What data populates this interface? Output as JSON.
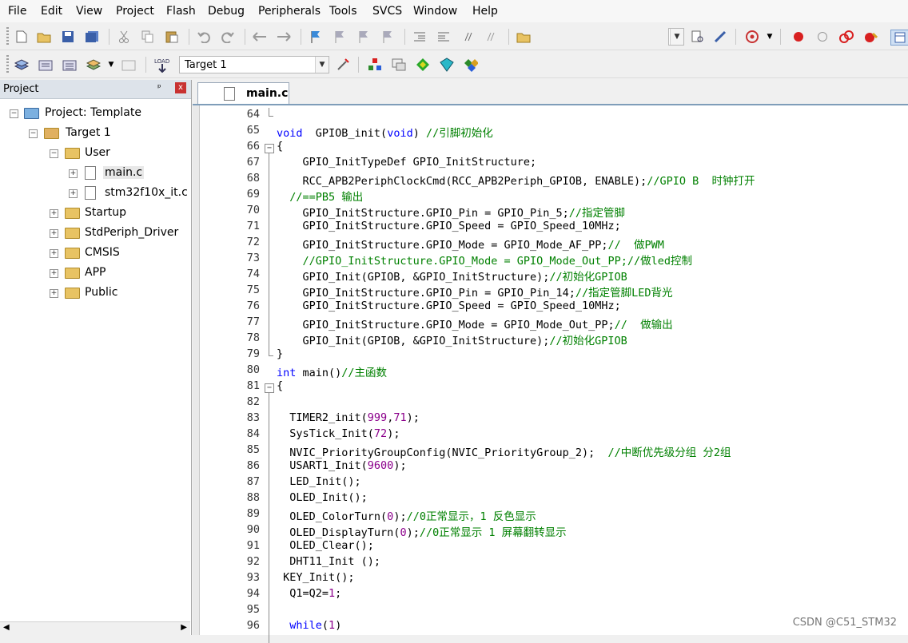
{
  "menu": [
    "File",
    "Edit",
    "View",
    "Project",
    "Flash",
    "Debug",
    "Peripherals",
    "Tools",
    "SVCS",
    "Window",
    "Help"
  ],
  "toolbar": {
    "target": "Target 1"
  },
  "project_panel": {
    "title": "Project",
    "pin": "ᵖ",
    "close": "x",
    "tree": [
      {
        "label": "Project: Template",
        "expander": "−"
      },
      {
        "label": "Target 1",
        "expander": "−"
      },
      {
        "label": "User",
        "expander": "−"
      },
      {
        "label": "main.c",
        "expander": "+"
      },
      {
        "label": "stm32f10x_it.c",
        "expander": "+"
      },
      {
        "label": "Startup",
        "expander": "+"
      },
      {
        "label": "StdPeriph_Driver",
        "expander": "+"
      },
      {
        "label": "CMSIS",
        "expander": "+"
      },
      {
        "label": "APP",
        "expander": "+"
      },
      {
        "label": "Public",
        "expander": "+"
      }
    ]
  },
  "editor": {
    "tab": "main.c",
    "lines": [
      {
        "n": "64",
        "p": []
      },
      {
        "n": "65",
        "p": [
          [
            "kw",
            "void"
          ],
          [
            "",
            "  GPIOB_init("
          ],
          [
            "kw",
            "void"
          ],
          [
            "",
            ") "
          ],
          [
            "cm",
            "//引脚初始化"
          ]
        ]
      },
      {
        "n": "66",
        "p": [
          [
            "",
            "{"
          ]
        ]
      },
      {
        "n": "67",
        "p": [
          [
            "",
            "    GPIO_InitTypeDef GPIO_InitStructure;"
          ]
        ]
      },
      {
        "n": "68",
        "p": [
          [
            "",
            "    RCC_APB2PeriphClockCmd(RCC_APB2Periph_GPIOB, ENABLE);"
          ],
          [
            "cm",
            "//GPIO B  时钟打开"
          ]
        ]
      },
      {
        "n": "69",
        "p": [
          [
            "cm",
            "  //==PB5 输出"
          ]
        ]
      },
      {
        "n": "70",
        "p": [
          [
            "",
            "    GPIO_InitStructure.GPIO_Pin = GPIO_Pin_5;"
          ],
          [
            "cm",
            "//指定管脚"
          ]
        ]
      },
      {
        "n": "71",
        "p": [
          [
            "",
            "    GPIO_InitStructure.GPIO_Speed = GPIO_Speed_10MHz;"
          ]
        ]
      },
      {
        "n": "72",
        "p": [
          [
            "",
            "    GPIO_InitStructure.GPIO_Mode = GPIO_Mode_AF_PP;"
          ],
          [
            "cm",
            "//  做PWM"
          ]
        ]
      },
      {
        "n": "73",
        "p": [
          [
            "cm",
            "    //GPIO_InitStructure.GPIO_Mode = GPIO_Mode_Out_PP;//做led控制"
          ]
        ]
      },
      {
        "n": "74",
        "p": [
          [
            "",
            "    GPIO_Init(GPIOB, &GPIO_InitStructure);"
          ],
          [
            "cm",
            "//初始化GPIOB"
          ]
        ]
      },
      {
        "n": "75",
        "p": [
          [
            "",
            "    GPIO_InitStructure.GPIO_Pin = GPIO_Pin_14;"
          ],
          [
            "cm",
            "//指定管脚LED背光"
          ]
        ]
      },
      {
        "n": "76",
        "p": [
          [
            "",
            "    GPIO_InitStructure.GPIO_Speed = GPIO_Speed_10MHz;"
          ]
        ]
      },
      {
        "n": "77",
        "p": [
          [
            "",
            "    GPIO_InitStructure.GPIO_Mode = GPIO_Mode_Out_PP;"
          ],
          [
            "cm",
            "//  做输出"
          ]
        ]
      },
      {
        "n": "78",
        "p": [
          [
            "",
            "    GPIO_Init(GPIOB, &GPIO_InitStructure);"
          ],
          [
            "cm",
            "//初始化GPIOB"
          ]
        ]
      },
      {
        "n": "79",
        "p": [
          [
            "",
            "}"
          ]
        ]
      },
      {
        "n": "80",
        "p": [
          [
            "kw",
            "int"
          ],
          [
            "",
            " main()"
          ],
          [
            "cm",
            "//主函数"
          ]
        ]
      },
      {
        "n": "81",
        "p": [
          [
            "",
            "{"
          ]
        ]
      },
      {
        "n": "82",
        "p": []
      },
      {
        "n": "83",
        "p": [
          [
            "",
            "  TIMER2_init("
          ],
          [
            "nm",
            "999"
          ],
          [
            "",
            ","
          ],
          [
            "nm",
            "71"
          ],
          [
            "",
            ");"
          ]
        ]
      },
      {
        "n": "84",
        "p": [
          [
            "",
            "  SysTick_Init("
          ],
          [
            "nm",
            "72"
          ],
          [
            "",
            ");"
          ]
        ]
      },
      {
        "n": "85",
        "p": [
          [
            "",
            "  NVIC_PriorityGroupConfig(NVIC_PriorityGroup_2);  "
          ],
          [
            "cm",
            "//中断优先级分组 分2组"
          ]
        ]
      },
      {
        "n": "86",
        "p": [
          [
            "",
            "  USART1_Init("
          ],
          [
            "nm",
            "9600"
          ],
          [
            "",
            ");"
          ]
        ]
      },
      {
        "n": "87",
        "p": [
          [
            "",
            "  LED_Init();"
          ]
        ]
      },
      {
        "n": "88",
        "p": [
          [
            "",
            "  OLED_Init();"
          ]
        ]
      },
      {
        "n": "89",
        "p": [
          [
            "",
            "  OLED_ColorTurn("
          ],
          [
            "nm",
            "0"
          ],
          [
            "",
            ");"
          ],
          [
            "cm",
            "//0正常显示，1 反色显示"
          ]
        ]
      },
      {
        "n": "90",
        "p": [
          [
            "",
            "  OLED_DisplayTurn("
          ],
          [
            "nm",
            "0"
          ],
          [
            "",
            ");"
          ],
          [
            "cm",
            "//0正常显示 1 屏幕翻转显示"
          ]
        ]
      },
      {
        "n": "91",
        "p": [
          [
            "",
            "  OLED_Clear();"
          ]
        ]
      },
      {
        "n": "92",
        "p": [
          [
            "",
            "  DHT11_Init ();"
          ]
        ]
      },
      {
        "n": "93",
        "p": [
          [
            "",
            " KEY_Init();"
          ]
        ]
      },
      {
        "n": "94",
        "p": [
          [
            "",
            "  Q1=Q2="
          ],
          [
            "nm",
            "1"
          ],
          [
            "",
            ";"
          ]
        ]
      },
      {
        "n": "95",
        "p": []
      },
      {
        "n": "96",
        "p": [
          [
            "kw",
            "  while"
          ],
          [
            "",
            "("
          ],
          [
            "nm",
            "1"
          ],
          [
            "",
            ")"
          ]
        ]
      }
    ]
  },
  "watermark": "CSDN @C51_STM32",
  "colors": {
    "keyword": "#0000ff",
    "comment": "#008000",
    "number": "#8b008b"
  }
}
